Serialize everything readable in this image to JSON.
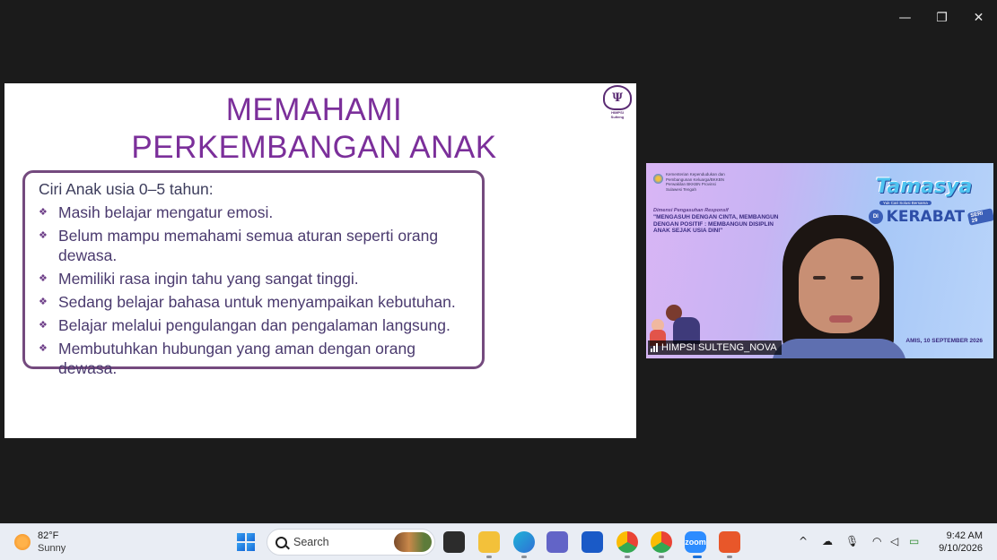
{
  "window_controls": {
    "minimize": "—",
    "restore": "❐",
    "close": "✕"
  },
  "slide": {
    "logo_text": "HIMPSI\nSulteng",
    "title_line1": "MEMAHAMI",
    "title_line2": "PERKEMBANGAN ANAK",
    "heading": "Ciri Anak usia 0–5 tahun:",
    "bullet_glyph": "❖",
    "bullets": [
      "Masih belajar mengatur emosi.",
      "Belum mampu memahami semua aturan seperti orang dewasa.",
      "Memiliki rasa ingin tahu yang sangat tinggi.",
      "Sedang belajar bahasa untuk menyampaikan kebutuhan.",
      "Belajar melalui pengulangan dan pengalaman langsung.",
      "Membutuhkan hubungan yang aman dengan orang dewasa."
    ]
  },
  "video": {
    "org_text": "Kementerian Kependudukan dan Pembangunan Keluarga/BKKBN Perwakilan BKKBN Provinsi Sulawesi Tengah",
    "theme": "Dimensi Pengasuhan Responsif",
    "quote": "\"MENGASUH DENGAN CINTA, MEMBANGUN DENGAN POSITIF : MEMBANGUN DISIPLIN ANAK SEJAK USIA DINI\"",
    "brand": "Tamasya",
    "brand_sub": "Yuk Cari Solusi Bersama",
    "di": "DI",
    "kerabat": "KERABAT",
    "seri": "SERI 29",
    "date": "AMIS, 10 SEPTEMBER 2026",
    "participant_name": "HIMPSI SULTENG_NOVA"
  },
  "taskbar": {
    "weather_temp": "82°F",
    "weather_cond": "Sunny",
    "search_label": "Search",
    "apps": [
      {
        "name": "file-explorer-app",
        "label": ""
      },
      {
        "name": "edge-app",
        "label": ""
      },
      {
        "name": "teams-app",
        "label": ""
      },
      {
        "name": "store-app",
        "label": ""
      },
      {
        "name": "chrome-app",
        "label": ""
      },
      {
        "name": "chrome-app-2",
        "label": ""
      },
      {
        "name": "zoom-app",
        "label": "zoom"
      },
      {
        "name": "office-app",
        "label": ""
      }
    ],
    "tray": {
      "chevron": "^",
      "wifi": "◠",
      "volume": "◁",
      "battery": "▭"
    },
    "time": "9:42 AM",
    "date": "9/10/2026"
  },
  "colors": {
    "slide_title": "#7b2f9a",
    "box_border": "#744a7e",
    "taskbar_bg": "#e9edf4",
    "backdrop": "#1b1b1b"
  }
}
